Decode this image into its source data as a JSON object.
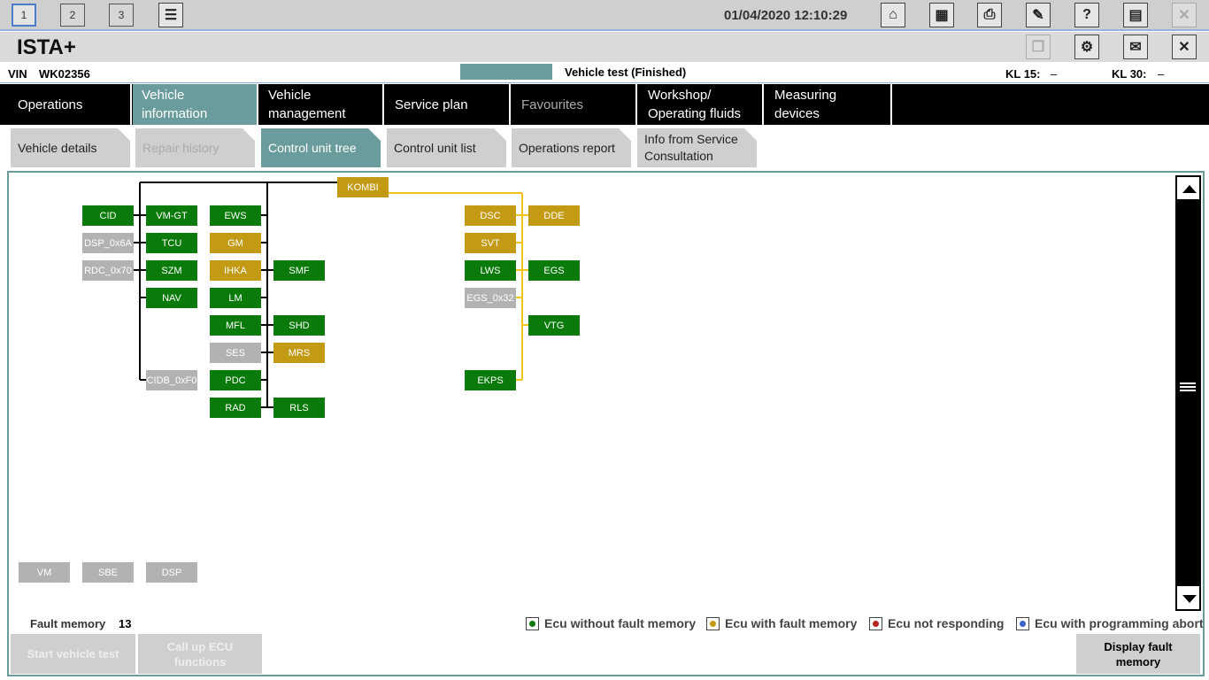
{
  "toolbar": {
    "sessions": [
      "1",
      "2",
      "3"
    ],
    "datetime": "01/04/2020 12:10:29"
  },
  "app": {
    "title": "ISTA+"
  },
  "vehicle": {
    "vin_label": "VIN",
    "vin": "WK02356",
    "test_status": "Vehicle test (Finished)",
    "kl15_label": "KL 15:",
    "kl15_value": "–",
    "kl30_label": "KL 30:",
    "kl30_value": "–"
  },
  "main_nav": [
    {
      "label": "Operations"
    },
    {
      "label": "Vehicle information"
    },
    {
      "label": "Vehicle management"
    },
    {
      "label": "Service plan"
    },
    {
      "label": "Favourites"
    },
    {
      "label": "Workshop/ Operating fluids"
    },
    {
      "label": "Measuring devices"
    }
  ],
  "sub_tabs": [
    {
      "label": "Vehicle details"
    },
    {
      "label": "Repair history"
    },
    {
      "label": "Control unit tree"
    },
    {
      "label": "Control unit list"
    },
    {
      "label": "Operations report"
    },
    {
      "label": "Info from Service Consultation"
    }
  ],
  "ecus": {
    "kombi": "KOMBI",
    "cid": "CID",
    "dsp_0x6a": "DSP_0x6A",
    "rdc_0x70": "RDC_0x70",
    "vm_gt": "VM-GT",
    "tcu": "TCU",
    "szm": "SZM",
    "nav": "NAV",
    "cidb_0xf0": "CIDB_0xF0",
    "ews": "EWS",
    "gm": "GM",
    "ihka": "IHKA",
    "lm": "LM",
    "mfl": "MFL",
    "ses": "SES",
    "pdc": "PDC",
    "rad": "RAD",
    "smf": "SMF",
    "shd": "SHD",
    "mrs": "MRS",
    "rls": "RLS",
    "dsc": "DSC",
    "svt": "SVT",
    "lws": "LWS",
    "egs_0x32": "EGS_0x32",
    "ekps": "EKPS",
    "dde": "DDE",
    "egs": "EGS",
    "vtg": "VTG",
    "vm": "VM",
    "sbe": "SBE",
    "dsp": "DSP"
  },
  "status_colors": {
    "ok": "#0a7a0a",
    "fault": "#c29a14",
    "not_responding": "#b52222",
    "programming_abort": "#3a62c8",
    "unidentified": "#b2b2b2",
    "accent": "#6a9c9e"
  },
  "footer": {
    "fault_memory_label": "Fault memory",
    "fault_memory_count": "13",
    "legend": [
      {
        "label": "Ecu without fault memory",
        "color": "#0a7a0a"
      },
      {
        "label": "Ecu with fault memory",
        "color": "#c29a14"
      },
      {
        "label": "Ecu not responding",
        "color": "#b52222"
      },
      {
        "label": "Ecu with programming abort",
        "color": "#3a62c8"
      }
    ],
    "start_vehicle_test": "Start vehicle test",
    "call_up_ecu": "Call up ECU functions",
    "display_fault_memory": "Display fault memory"
  }
}
